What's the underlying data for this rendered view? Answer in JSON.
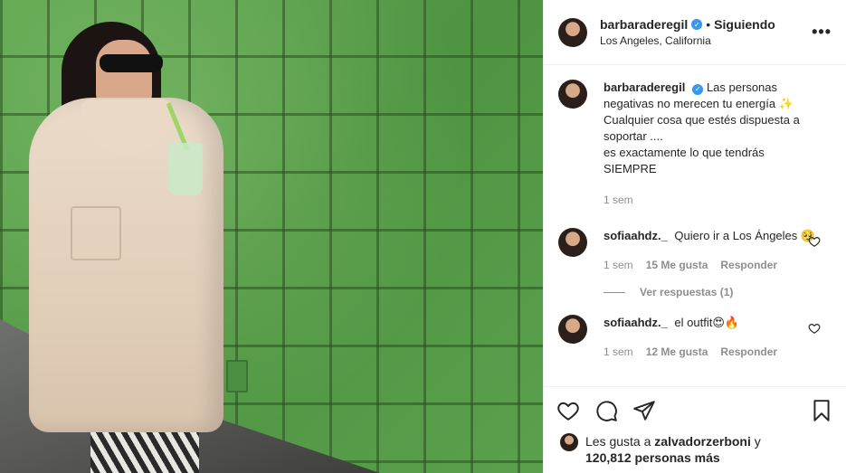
{
  "header": {
    "username": "barbaraderegil",
    "separator": "•",
    "follow_label": "Siguiendo",
    "location": "Los Angeles, California",
    "more": "•••"
  },
  "caption": {
    "username": "barbaraderegil",
    "lines": [
      "Las personas",
      "negativas no merecen tu energía ✨",
      "Cualquier cosa que estés dispuesta a",
      "soportar ....",
      "es exactamente lo que tendrás",
      "SIEMPRE"
    ],
    "time": "1 sem"
  },
  "comments": [
    {
      "username": "sofiaahdz._",
      "text": "Quiero ir a Los Ángeles 🥺",
      "time": "1 sem",
      "likes": "15 Me gusta",
      "reply": "Responder",
      "view_replies": "Ver respuestas (1)"
    },
    {
      "username": "sofiaahdz._",
      "text": "el outfit😍🔥",
      "time": "1 sem",
      "likes": "12 Me gusta",
      "reply": "Responder"
    }
  ],
  "likes": {
    "prefix": "Les gusta a",
    "user": "zalvadorzerboni",
    "joiner": "y",
    "count": "120,812 personas más"
  },
  "icons": {
    "like": "heart-icon",
    "comment": "comment-icon",
    "share": "paper-plane-icon",
    "save": "bookmark-icon"
  },
  "colors": {
    "verified": "#3897f0",
    "text": "#262626",
    "muted": "#8e8e8e",
    "wall": "#5a9e4c"
  }
}
